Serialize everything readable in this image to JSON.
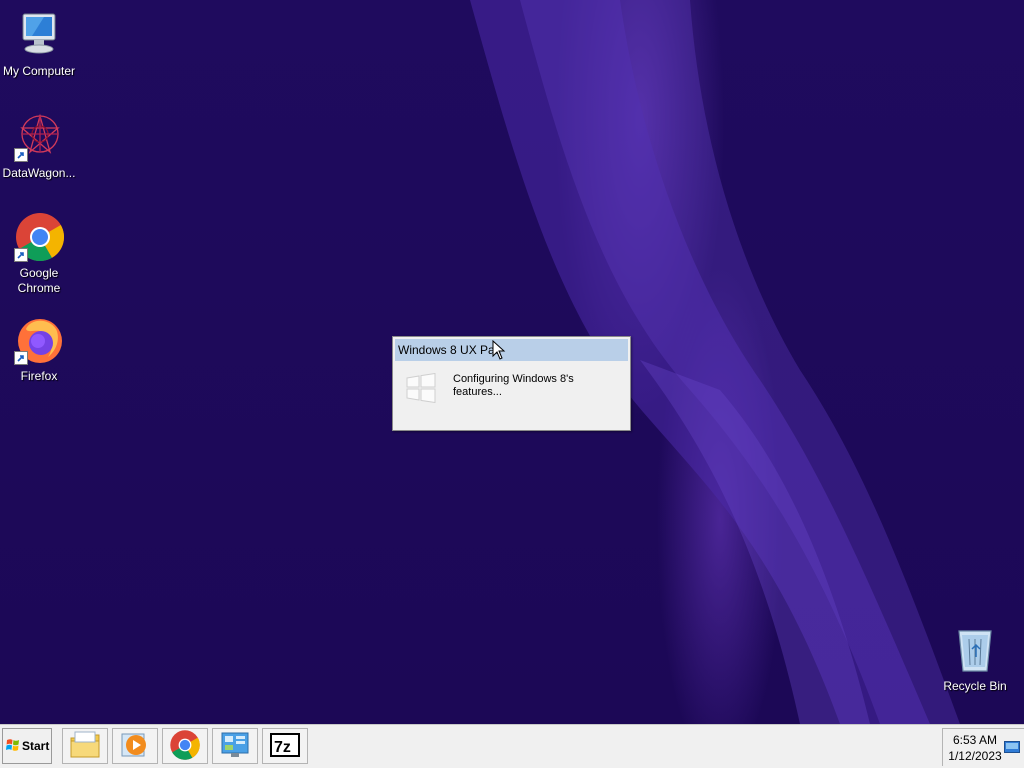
{
  "desktop": {
    "icons": [
      {
        "label": "My Computer",
        "icon": "my-computer-icon"
      },
      {
        "label": "DataWagon...",
        "icon": "datawagon-icon"
      },
      {
        "label": "Google Chrome",
        "icon": "chrome-icon"
      },
      {
        "label": "Firefox",
        "icon": "firefox-icon"
      },
      {
        "label": "Recycle Bin",
        "icon": "recycle-bin-icon"
      }
    ]
  },
  "dialog": {
    "title": "Windows 8 UX Pac",
    "message": "Configuring Windows 8's features..."
  },
  "taskbar": {
    "start_label": "Start",
    "pinned": [
      "file-explorer-icon",
      "media-player-icon",
      "chrome-icon",
      "control-panel-icon",
      "7zip-icon"
    ],
    "clock": {
      "time": "6:53 AM",
      "date": "1/12/2023"
    }
  },
  "colors": {
    "desktop_background": "#1d0a58",
    "dialog_title_bar": "#b9cfe8",
    "taskbar": "#f0f0f0"
  }
}
